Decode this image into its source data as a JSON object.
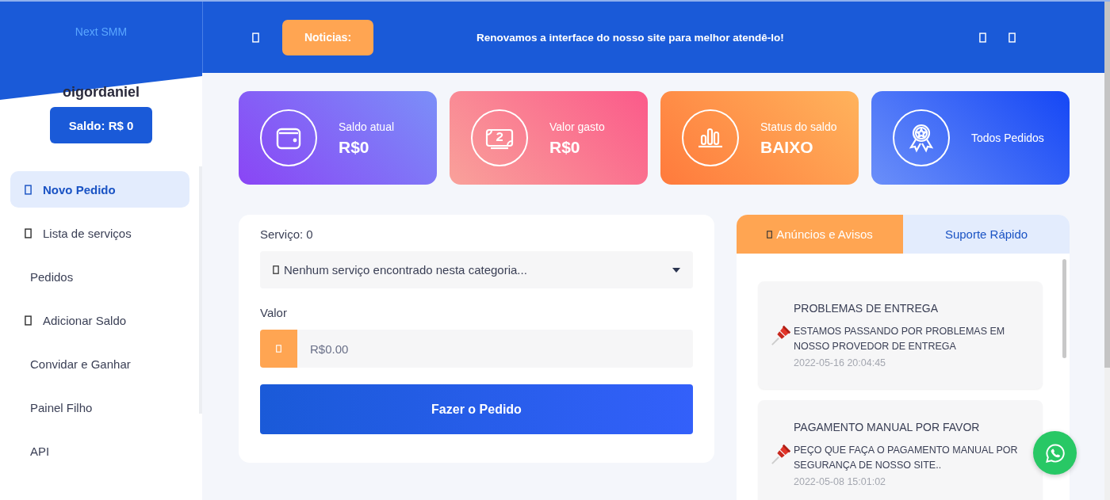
{
  "brand": "Next SMM",
  "user": {
    "name": "oigordaniel",
    "balance": "Saldo: R$ 0"
  },
  "sidebar": {
    "items": [
      {
        "label": "Novo Pedido",
        "icon": true,
        "selected": true
      },
      {
        "label": "Lista de serviços",
        "icon": true,
        "selected": false
      },
      {
        "label": "Pedidos",
        "icon": false,
        "selected": false
      },
      {
        "label": "Adicionar Saldo",
        "icon": true,
        "selected": false
      },
      {
        "label": "Convidar e Ganhar",
        "icon": false,
        "selected": false
      },
      {
        "label": "Painel Filho",
        "icon": false,
        "selected": false
      },
      {
        "label": "API",
        "icon": false,
        "selected": false
      }
    ]
  },
  "topbar": {
    "news_label": "Noticias:",
    "news_text": "Renovamos a interface do nosso site para melhor atendê-lo!"
  },
  "stats": [
    {
      "kind": "wallet",
      "label": "Saldo atual",
      "value": "R$0"
    },
    {
      "kind": "money",
      "label": "Valor gasto",
      "value": "R$0"
    },
    {
      "kind": "chart",
      "label": "Status do saldo",
      "value": "BAIXO"
    },
    {
      "kind": "award",
      "label": "Todos Pedidos"
    }
  ],
  "order_form": {
    "service_label": "Serviço: 0",
    "service_value": "Nenhum serviço encontrado nesta categoria...",
    "amount_label": "Valor",
    "amount_placeholder": "R$0.00",
    "submit": "Fazer o Pedido"
  },
  "tabs": [
    {
      "label": "Anúncios e Avisos",
      "icon": true,
      "selected": true
    },
    {
      "label": "Suporte Rápido",
      "icon": false,
      "selected": false
    }
  ],
  "announcements": [
    {
      "title": "PROBLEMAS DE ENTREGA",
      "text": "ESTAMOS PASSANDO POR PROBLEMAS EM NOSSO PROVEDOR DE ENTREGA",
      "date": "2022-05-16 20:04:45"
    },
    {
      "title": "PAGAMENTO MANUAL POR FAVOR",
      "text": "PEÇO QUE FAÇA O PAGAMENTO MANUAL POR SEGURANÇA DE NOSSO SITE..",
      "date": "2022-05-08 15:01:02"
    }
  ]
}
